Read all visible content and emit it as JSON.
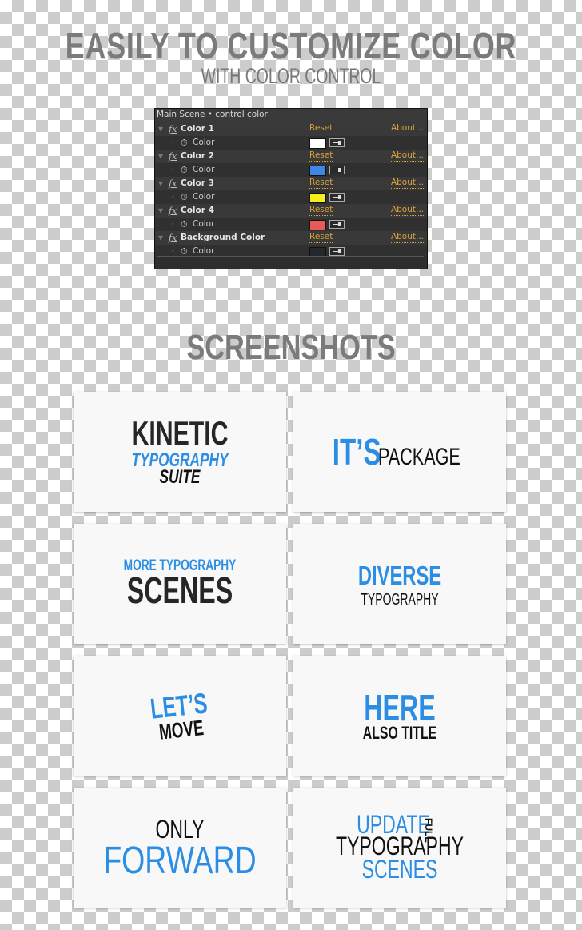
{
  "header": {
    "title": "EASILY TO CUSTOMIZE COLOR",
    "subtitle": "WITH COLOR CONTROL"
  },
  "panel": {
    "title": "Main Scene • control color",
    "effects": [
      {
        "name": "Color 1",
        "reset": "Reset",
        "about": "About...",
        "property": "Color",
        "swatch": "#ffffff"
      },
      {
        "name": "Color 2",
        "reset": "Reset",
        "about": "About...",
        "property": "Color",
        "swatch": "#3f86e6"
      },
      {
        "name": "Color 3",
        "reset": "Reset",
        "about": "About...",
        "property": "Color",
        "swatch": "#f4ee1c"
      },
      {
        "name": "Color 4",
        "reset": "Reset",
        "about": "About...",
        "property": "Color",
        "swatch": "#e85a5a"
      },
      {
        "name": "Background Color",
        "reset": "Reset",
        "about": "About...",
        "property": "Color",
        "swatch": "#23282c"
      }
    ],
    "icons": {
      "expand": "triangle-down-icon",
      "fx": "fx-icon",
      "stopwatch": "stopwatch-icon",
      "eyedropper": "eyedropper-icon"
    }
  },
  "screenshots": {
    "title": "SCREENSHOTS",
    "colors": {
      "accent": "#2b8ee4",
      "dark": "#262626"
    },
    "cards": [
      {
        "lines": [
          "KINETIC",
          "TYPOGRAPHY",
          "SUITE"
        ]
      },
      {
        "lines": [
          "IT’S",
          "PACKAGE"
        ]
      },
      {
        "lines": [
          "MORE TYPOGRAPHY",
          "SCENES"
        ]
      },
      {
        "lines": [
          "DIVERSE",
          "TYPOGRAPHY"
        ]
      },
      {
        "lines": [
          "LET’S",
          "MOVE"
        ]
      },
      {
        "lines": [
          "HERE",
          "ALSO TITLE"
        ]
      },
      {
        "lines": [
          "ONLY",
          "FORWARD"
        ]
      },
      {
        "lines": [
          "UPDATE",
          "FULL",
          "TYPOGRAPHY",
          "SCENES"
        ]
      }
    ]
  }
}
